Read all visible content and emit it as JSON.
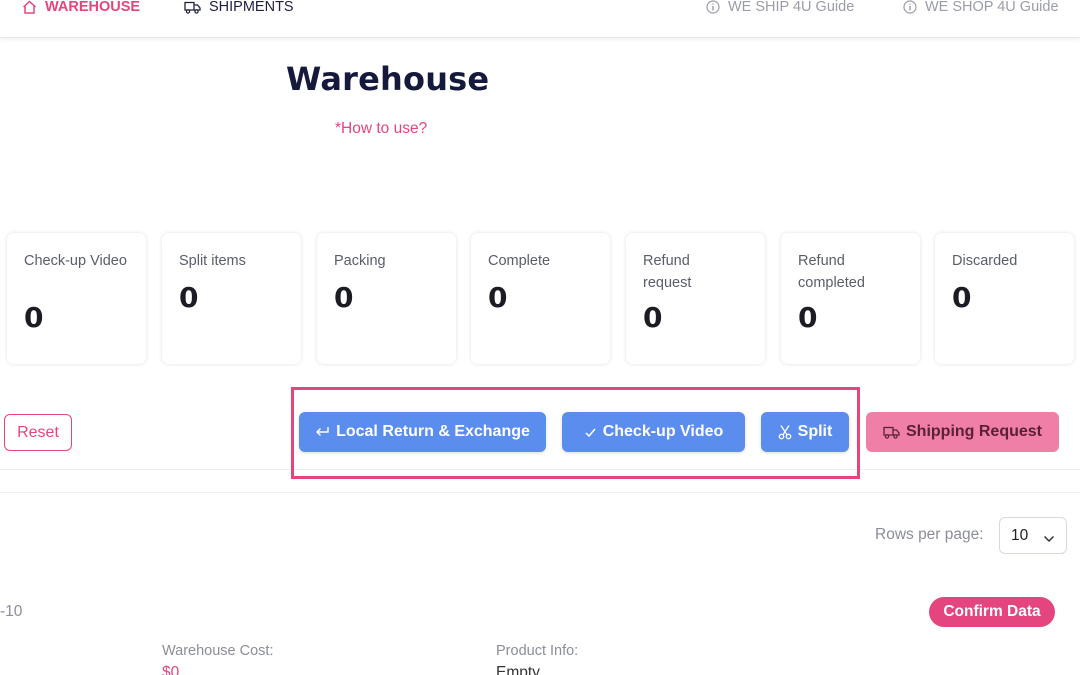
{
  "nav": {
    "warehouse": "WAREHOUSE",
    "shipments": "SHIPMENTS",
    "guide_ship": "WE SHIP 4U Guide",
    "guide_shop": "WE SHOP 4U Guide"
  },
  "header": {
    "title": "Warehouse",
    "how_to": "*How to use?"
  },
  "stats": [
    {
      "label": "Check-up Video",
      "value": "0"
    },
    {
      "label": "Split items",
      "value": "0"
    },
    {
      "label": "Packing",
      "value": "0"
    },
    {
      "label": "Complete",
      "value": "0"
    },
    {
      "label": "Refund request",
      "value": "0"
    },
    {
      "label": "Refund completed",
      "value": "0"
    },
    {
      "label": "Discarded",
      "value": "0"
    }
  ],
  "actions": {
    "reset": "Reset",
    "local_return": "Local Return & Exchange",
    "checkup_video": "Check-up Video",
    "split": "Split",
    "shipping_request": "Shipping Request"
  },
  "pagination": {
    "rows_label": "Rows per page:",
    "rows_value": "10"
  },
  "item": {
    "range": "-10",
    "confirm": "Confirm Data",
    "warehouse_cost_label": "Warehouse Cost:",
    "warehouse_cost_value": "$0",
    "product_info_label": "Product Info:",
    "product_info_value": "Empty"
  },
  "colors": {
    "accent": "#e5457f",
    "primary_blue": "#5b8def",
    "title": "#151a3c"
  }
}
